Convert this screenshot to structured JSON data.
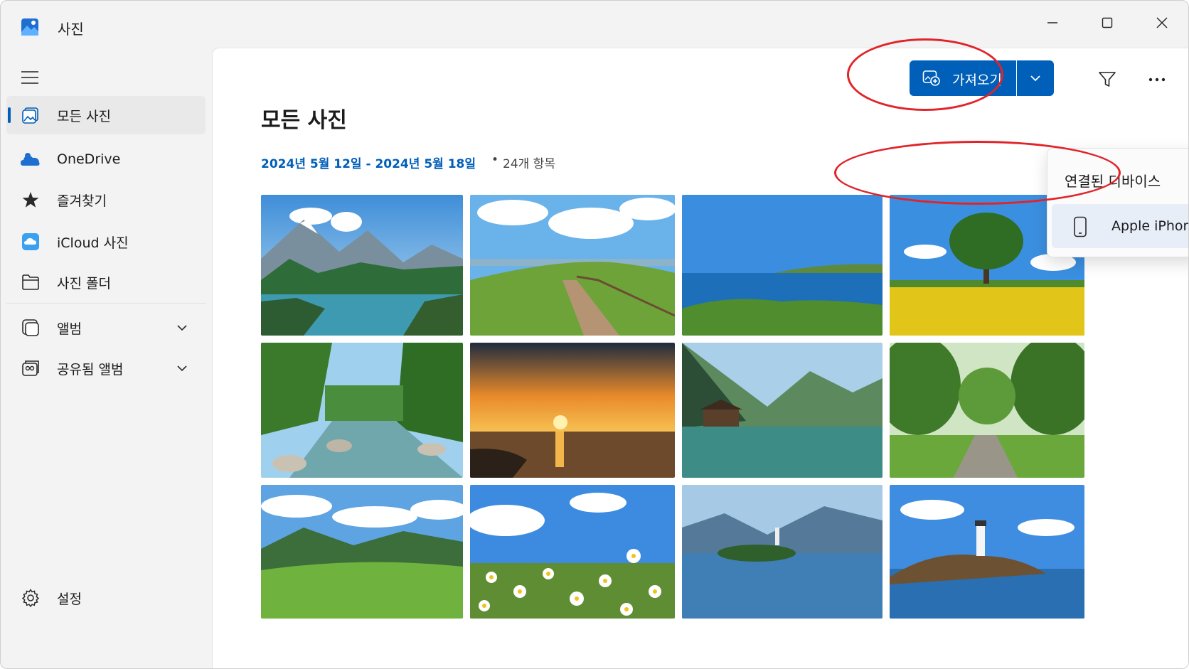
{
  "app": {
    "title": "사진",
    "icon": "photos-app-icon"
  },
  "window_controls": {
    "minimize": "minimize-icon",
    "maximize": "maximize-icon",
    "close": "close-icon"
  },
  "sidebar": {
    "items": [
      {
        "label": "모든 사진",
        "icon": "photos-icon",
        "active": true
      },
      {
        "label": "OneDrive",
        "icon": "onedrive-icon"
      },
      {
        "label": "즐겨찾기",
        "icon": "star-icon"
      },
      {
        "label": "iCloud 사진",
        "icon": "icloud-icon"
      },
      {
        "label": "사진 폴더",
        "icon": "folder-icon"
      },
      {
        "label": "앨범",
        "icon": "album-icon",
        "expandable": true
      },
      {
        "label": "공유됨 앨범",
        "icon": "shared-album-icon",
        "expandable": true
      }
    ],
    "settings_label": "설정"
  },
  "main": {
    "title": "모든 사진",
    "date_range": "2024년 5월 12일 - 2024년 5월 18일",
    "separator": "•",
    "item_count": "24개 항목"
  },
  "toolbar": {
    "import_label": "가져오기",
    "import_icon": "import-icon",
    "dropdown_icon": "chevron-down-icon",
    "filter_icon": "filter-icon",
    "more_icon": "more-icon"
  },
  "flyout": {
    "header": "연결된 디바이스",
    "items": [
      {
        "label": "Apple iPhone",
        "icon": "phone-icon"
      }
    ]
  },
  "colors": {
    "accent": "#005fb8",
    "highlight_annotation": "#e0242a"
  },
  "photos": [
    {
      "subject": "mountain lake with pine trees"
    },
    {
      "subject": "wooden path on green hill"
    },
    {
      "subject": "sea coastline"
    },
    {
      "subject": "tree in yellow flower field"
    },
    {
      "subject": "forest river with rocks"
    },
    {
      "subject": "sunset over water"
    },
    {
      "subject": "cabin by mountain lake"
    },
    {
      "subject": "tree-lined path"
    },
    {
      "subject": "green valley with mountains"
    },
    {
      "subject": "daisy field under blue sky"
    },
    {
      "subject": "island with church on lake"
    },
    {
      "subject": "lighthouse on rocky coast"
    }
  ]
}
